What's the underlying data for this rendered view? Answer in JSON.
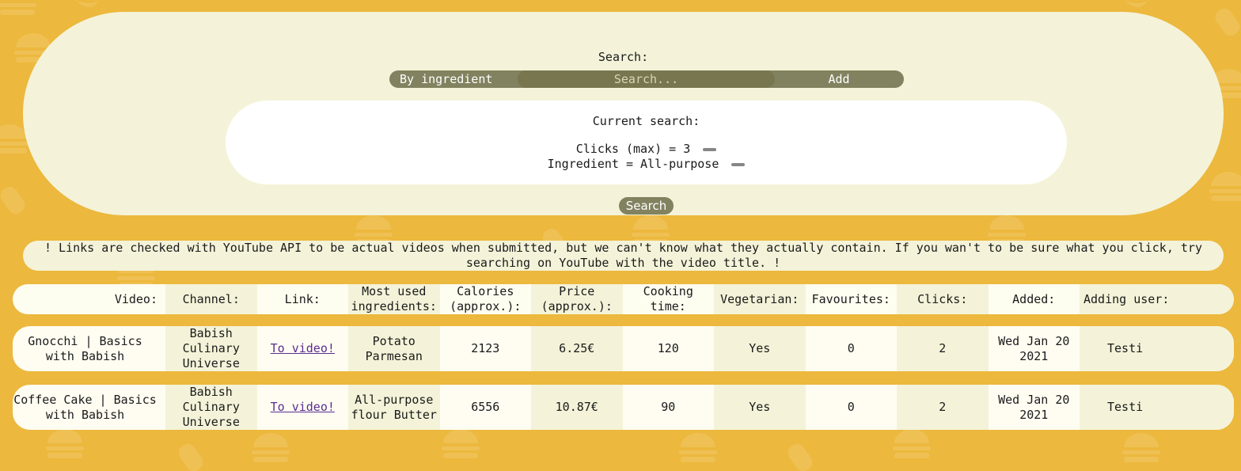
{
  "search": {
    "title": "Search:",
    "mode_label": "By ingredient",
    "input_value": "",
    "input_placeholder": "Search...",
    "add_label": "Add",
    "button_label": "Search"
  },
  "current_search": {
    "title": "Current search:",
    "criteria": [
      "Clicks (max) = 3",
      "Ingredient = All-purpose"
    ]
  },
  "notice": "! Links are checked with YouTube API to be actual videos when submitted, but we can't know what they actually contain. If you wan't to be sure what you click, try searching on YouTube with the video title. !",
  "table": {
    "headers": [
      "Video:",
      "Channel:",
      "Link:",
      "Most used ingredients:",
      "Calories (approx.):",
      "Price (approx.):",
      "Cooking time:",
      "Vegetarian:",
      "Favourites:",
      "Clicks:",
      "Added:",
      "Adding user:"
    ],
    "rows": [
      {
        "video": "Gnocchi | Basics with Babish",
        "channel": "Babish Culinary Universe",
        "link": "To video!",
        "ingredients": "Potato Parmesan",
        "calories": "2123",
        "price": "6.25€",
        "cooking_time": "120",
        "vegetarian": "Yes",
        "favourites": "0",
        "clicks": "2",
        "added": "Wed Jan 20 2021",
        "user": "Testi"
      },
      {
        "video": "Coffee Cake | Basics with Babish",
        "channel": "Babish Culinary Universe",
        "link": "To video!",
        "ingredients": "All-purpose flour Butter",
        "calories": "6556",
        "price": "10.87€",
        "cooking_time": "90",
        "vegetarian": "Yes",
        "favourites": "0",
        "clicks": "2",
        "added": "Wed Jan 20 2021",
        "user": "Testi"
      }
    ]
  },
  "colors": {
    "background": "#ecb83d",
    "panel": "#f4f3d9",
    "control": "#828260",
    "link": "#5a2e91"
  }
}
